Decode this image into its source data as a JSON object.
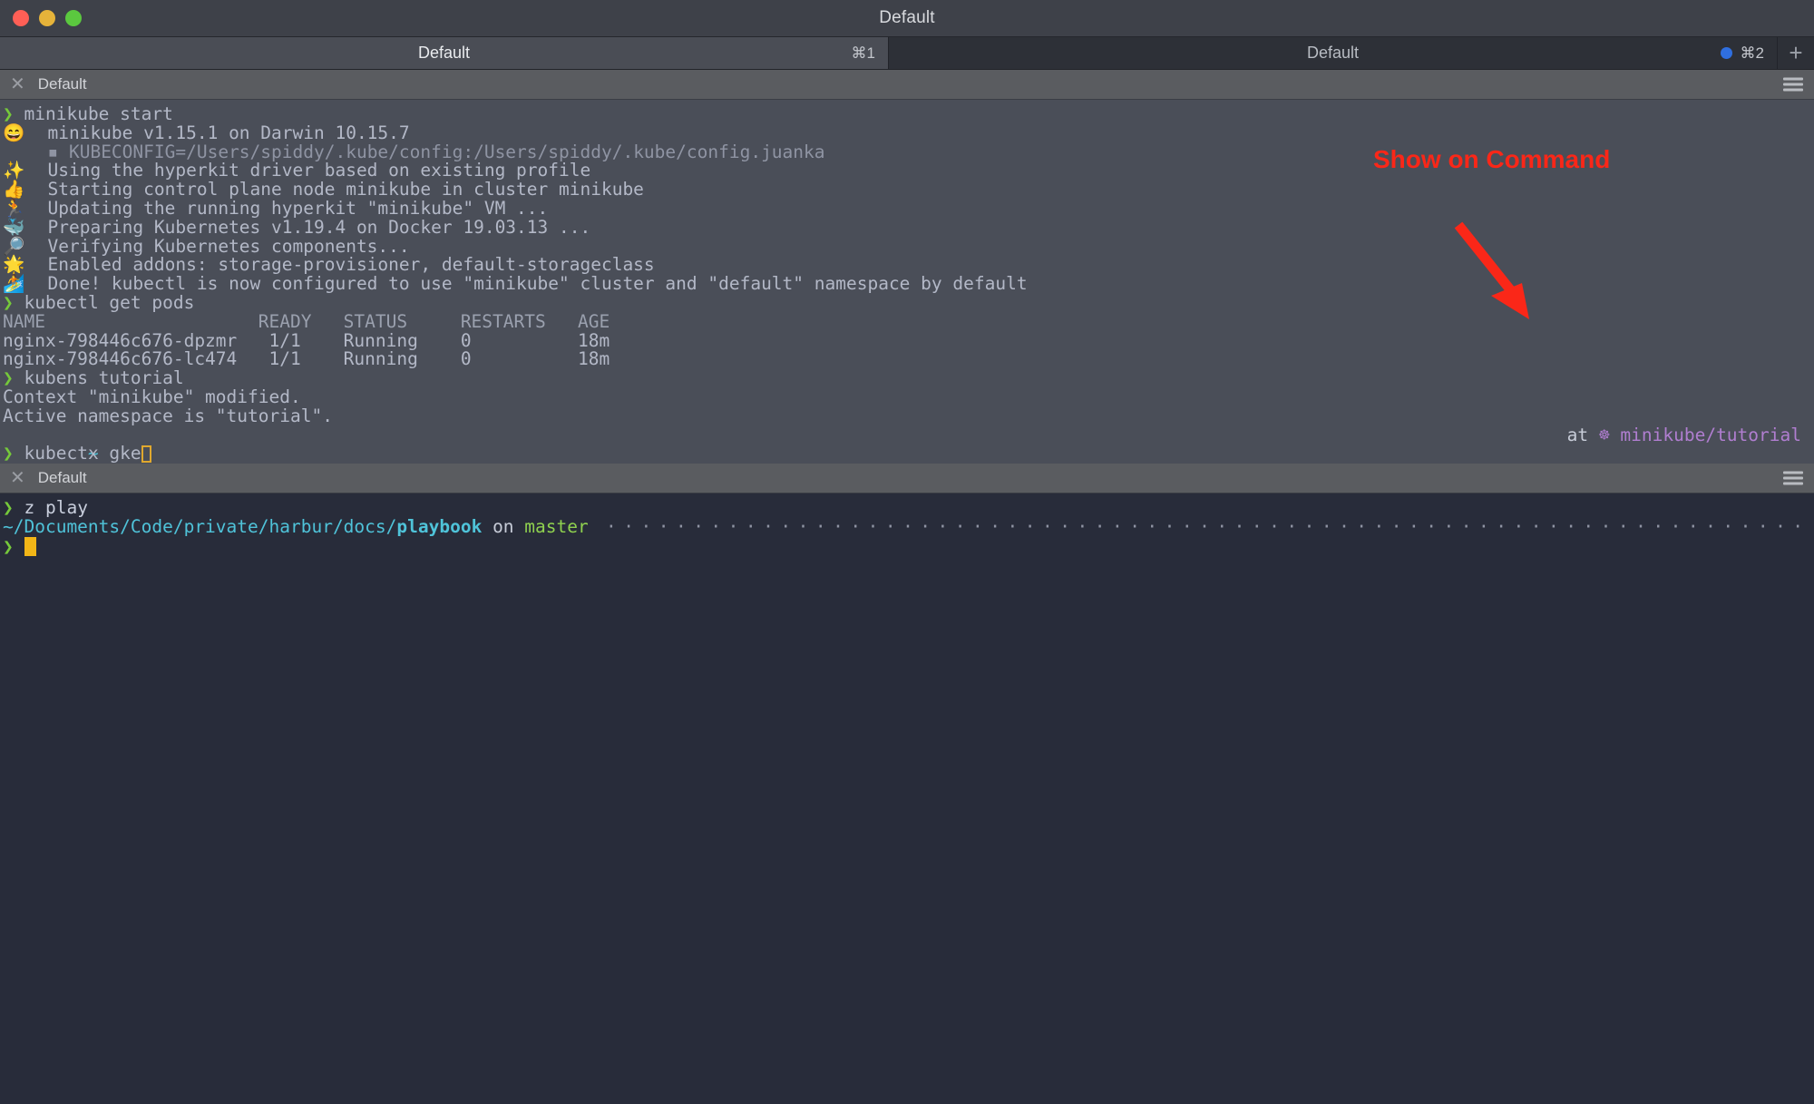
{
  "window": {
    "title": "Default",
    "traffic_lights": [
      "close",
      "minimize",
      "maximize"
    ]
  },
  "tabs": [
    {
      "label": "Default",
      "shortcut": "⌘1",
      "active": true,
      "has_activity_dot": false
    },
    {
      "label": "Default",
      "shortcut": "⌘2",
      "active": false,
      "has_activity_dot": true
    }
  ],
  "tab_add_label": "+",
  "panes": [
    {
      "header_label": "Default",
      "close_icon": "✕",
      "menu_icon": "hamburger",
      "lines": [
        {
          "type": "command",
          "prompt": "❯",
          "text": "minikube start"
        },
        {
          "type": "status",
          "emoji": "😄",
          "text": "minikube v1.15.1 on Darwin 10.15.7"
        },
        {
          "type": "status",
          "emoji": "",
          "indent": "  ▪ ",
          "text": "KUBECONFIG=/Users/spiddy/.kube/config:/Users/spiddy/.kube/config.juanka"
        },
        {
          "type": "status",
          "emoji": "✨",
          "text": "Using the hyperkit driver based on existing profile"
        },
        {
          "type": "status",
          "emoji": "👍",
          "text": "Starting control plane node minikube in cluster minikube"
        },
        {
          "type": "status",
          "emoji": "🏃",
          "text": "Updating the running hyperkit \"minikube\" VM ..."
        },
        {
          "type": "status",
          "emoji": "🐳",
          "text": "Preparing Kubernetes v1.19.4 on Docker 19.03.13 ..."
        },
        {
          "type": "status",
          "emoji": "🔎",
          "text": "Verifying Kubernetes components..."
        },
        {
          "type": "status",
          "emoji": "🌟",
          "text": "Enabled addons: storage-provisioner, default-storageclass"
        },
        {
          "type": "status",
          "emoji": "🏄",
          "text": "Done! kubectl is now configured to use \"minikube\" cluster and \"default\" namespace by default"
        },
        {
          "type": "command",
          "prompt": "❯",
          "text": "kubectl get pods"
        },
        {
          "type": "table_header",
          "text": "NAME                    READY   STATUS     RESTARTS   AGE"
        },
        {
          "type": "table_row",
          "text": "nginx-798446c676-dpzmr   1/1    Running    0          18m"
        },
        {
          "type": "table_row",
          "text": "nginx-798446c676-lc474   1/1    Running    0          18m"
        },
        {
          "type": "command",
          "prompt": "❯",
          "text": "kubens tutorial"
        },
        {
          "type": "output",
          "text": "Context \"minikube\" modified."
        },
        {
          "type": "output",
          "text": "Active namespace is \"tutorial\"."
        },
        {
          "type": "prompt_line",
          "left": "~",
          "right_prefix": "at",
          "right_symbol": "☸",
          "right_value": "minikube/tutorial"
        },
        {
          "type": "input",
          "prompt": "❯",
          "text": "kubectx gke",
          "cursor": "box"
        }
      ]
    },
    {
      "header_label": "Default",
      "close_icon": "✕",
      "menu_icon": "hamburger",
      "lines": [
        {
          "type": "command",
          "prompt": "❯",
          "text": "z play"
        },
        {
          "type": "path_line",
          "path_prefix": "~/Documents/Code/private/harbur/docs/",
          "path_bold": "playbook",
          "on_word": "on",
          "branch": "master"
        },
        {
          "type": "input",
          "prompt": "❯",
          "text": "",
          "cursor": "solid"
        }
      ]
    }
  ],
  "annotation": {
    "text": "Show on Command",
    "color": "#fa2718",
    "arrow": "down-right-arrow"
  },
  "colors": {
    "titlebar_bg": "#3e4149",
    "tab_active_bg": "#4a4d55",
    "tab_inactive_bg": "#2d3037",
    "pane_header_bg": "#5a5c60",
    "terminal_top_bg": "#4a4e58",
    "terminal_bottom_bg": "#282c3a",
    "prompt_green": "#76c93b",
    "output_grey": "#b3b8c7",
    "namespace_purple": "#b07ed0",
    "path_cyan": "#4fc3d9",
    "branch_green": "#8fd14f",
    "cursor_yellow": "#e0a82e",
    "activity_dot_blue": "#2f6fe0",
    "annotation_red": "#fa2718"
  }
}
